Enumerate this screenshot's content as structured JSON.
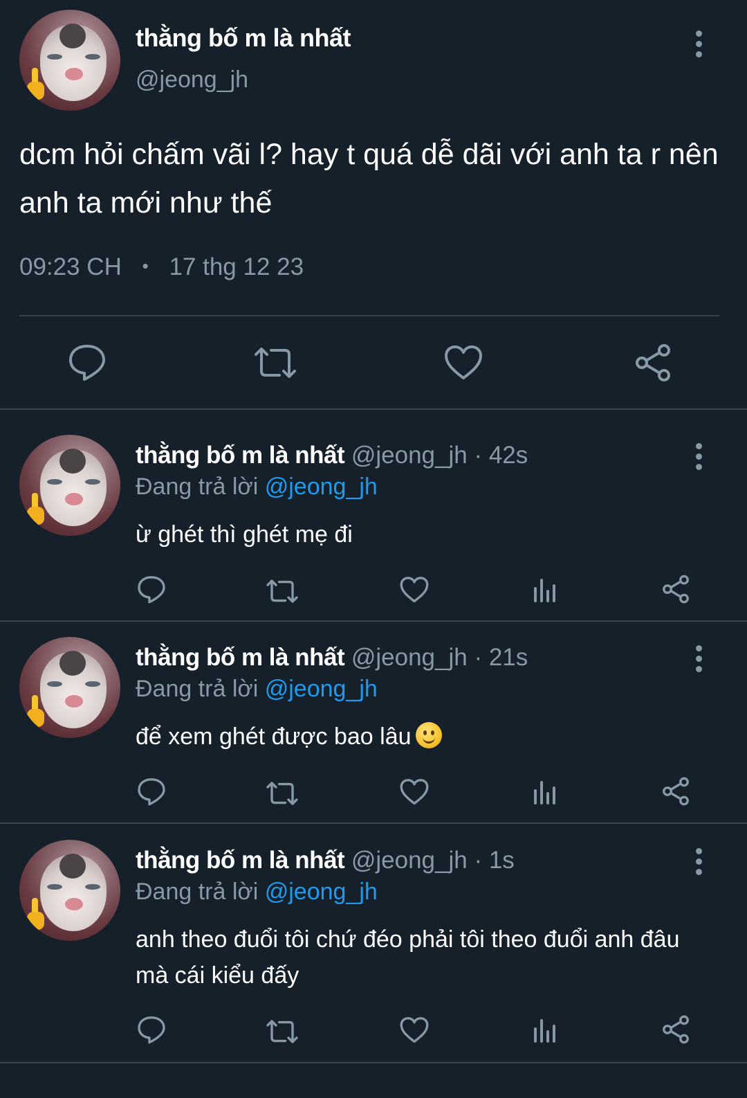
{
  "main_tweet": {
    "display_name": "thằng bố m là nhất",
    "handle": "@jeong_jh",
    "text": "dcm hỏi chấm vãi l? hay t quá dễ dãi với anh ta r nên anh ta mới như thế",
    "time": "09:23 CH",
    "separator": "•",
    "date": "17 thg 12 23",
    "icons": [
      "reply-icon",
      "retweet-icon",
      "like-icon",
      "share-icon"
    ]
  },
  "replies": [
    {
      "display_name": "thằng bố m là nhất",
      "handle": "@jeong_jh",
      "age": "· 42s",
      "replying_prefix": "Đang trả lời",
      "replying_to": "@jeong_jh",
      "text": "ừ ghét thì ghét mẹ đi"
    },
    {
      "display_name": "thằng bố m là nhất",
      "handle": "@jeong_jh",
      "age": "· 21s",
      "replying_prefix": "Đang trả lời",
      "replying_to": "@jeong_jh",
      "text": "để xem ghét được bao lâu",
      "emoji": "slightly-smiling-face"
    },
    {
      "display_name": "thằng bố m là nhất",
      "handle": "@jeong_jh",
      "age": "· 1s",
      "replying_prefix": "Đang trả lời",
      "replying_to": "@jeong_jh",
      "text": "anh theo đuổi tôi chứ đéo phải tôi theo đuổi anh đâu mà cái kiểu đấy"
    }
  ],
  "colors": {
    "background": "#15202b",
    "secondary_text": "#8899a6",
    "link": "#1d9bf0",
    "divider": "#38444d"
  }
}
